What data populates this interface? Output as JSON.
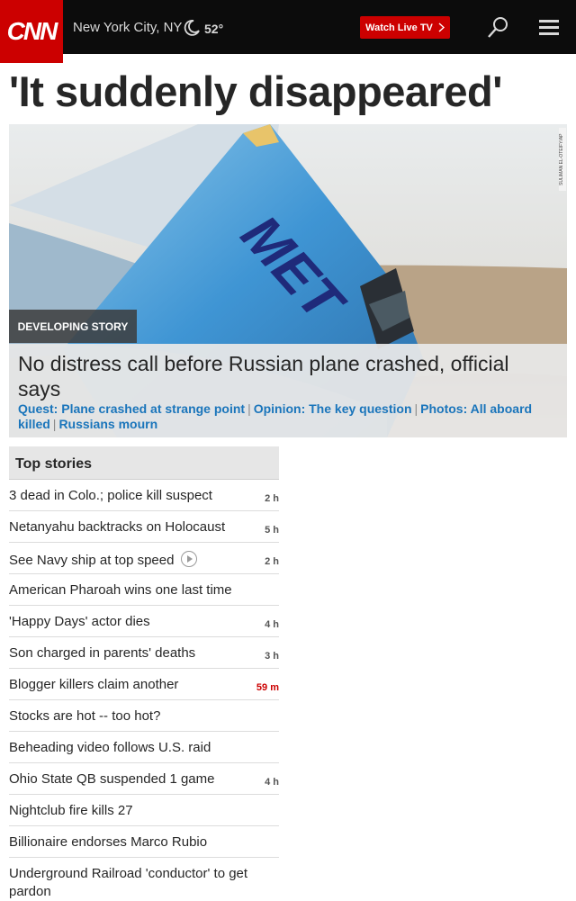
{
  "header": {
    "logo": "CNN",
    "location": "New York City, NY",
    "temperature": "52°",
    "live_button": "Watch Live TV",
    "icons": [
      "moon-icon",
      "search-icon",
      "menu-icon"
    ]
  },
  "main": {
    "headline": "'It suddenly disappeared'",
    "hero": {
      "photo_credit": "SULIMAN EL-OTEIFY/AP",
      "badge": "DEVELOPING STORY",
      "title": "No distress call before Russian plane crashed, official says",
      "links": [
        "Quest: Plane crashed at strange point",
        "Opinion: The key question",
        "Photos: All aboard killed",
        "Russians mourn"
      ]
    }
  },
  "top_stories": {
    "heading": "Top stories",
    "items": [
      {
        "title": "3 dead in Colo.; police kill suspect",
        "time": "2 h"
      },
      {
        "title": "Netanyahu backtracks on Holocaust",
        "time": "5 h"
      },
      {
        "title": "See Navy ship at top speed",
        "time": "2 h"
      },
      {
        "title": "American Pharoah wins one last time",
        "time": ""
      },
      {
        "title": "'Happy Days' actor dies",
        "time": "4 h"
      },
      {
        "title": "Son charged in parents' deaths",
        "time": "3 h"
      },
      {
        "title": "Blogger killers claim another",
        "time": "59 m"
      },
      {
        "title": "Stocks are hot -- too hot?",
        "time": ""
      },
      {
        "title": "Beheading video follows U.S. raid",
        "time": ""
      },
      {
        "title": "Ohio State QB suspended 1 game",
        "time": "4 h"
      },
      {
        "title": "Nightclub fire kills 27",
        "time": ""
      },
      {
        "title": "Billionaire endorses Marco Rubio",
        "time": ""
      },
      {
        "title": "Underground Railroad 'conductor' to get pardon",
        "time": ""
      }
    ]
  },
  "colors": {
    "brand": "#cc0000",
    "link": "#1a75bb",
    "topbar": "#0c0c0c"
  }
}
